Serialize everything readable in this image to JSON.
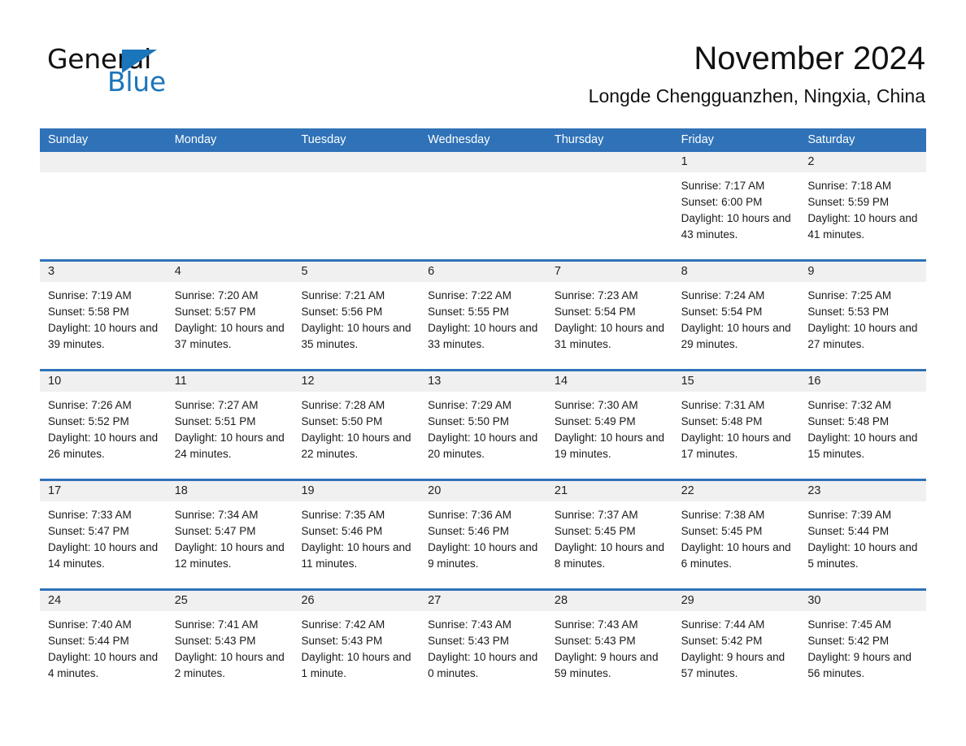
{
  "brand": {
    "name_part1": "General",
    "name_part2": "Blue"
  },
  "header": {
    "title": "November 2024",
    "subtitle": "Longde Chengguanzhen, Ningxia, China"
  },
  "colors": {
    "header_blue": "#2f72b8",
    "brand_blue": "#1b75bb",
    "day_band": "#f0f0f0",
    "text": "#1a1a1a"
  },
  "weekdays": [
    "Sunday",
    "Monday",
    "Tuesday",
    "Wednesday",
    "Thursday",
    "Friday",
    "Saturday"
  ],
  "weeks": [
    [
      {
        "day": "",
        "empty": true
      },
      {
        "day": "",
        "empty": true
      },
      {
        "day": "",
        "empty": true
      },
      {
        "day": "",
        "empty": true
      },
      {
        "day": "",
        "empty": true
      },
      {
        "day": "1",
        "sunrise": "Sunrise: 7:17 AM",
        "sunset": "Sunset: 6:00 PM",
        "daylight": "Daylight: 10 hours and 43 minutes."
      },
      {
        "day": "2",
        "sunrise": "Sunrise: 7:18 AM",
        "sunset": "Sunset: 5:59 PM",
        "daylight": "Daylight: 10 hours and 41 minutes."
      }
    ],
    [
      {
        "day": "3",
        "sunrise": "Sunrise: 7:19 AM",
        "sunset": "Sunset: 5:58 PM",
        "daylight": "Daylight: 10 hours and 39 minutes."
      },
      {
        "day": "4",
        "sunrise": "Sunrise: 7:20 AM",
        "sunset": "Sunset: 5:57 PM",
        "daylight": "Daylight: 10 hours and 37 minutes."
      },
      {
        "day": "5",
        "sunrise": "Sunrise: 7:21 AM",
        "sunset": "Sunset: 5:56 PM",
        "daylight": "Daylight: 10 hours and 35 minutes."
      },
      {
        "day": "6",
        "sunrise": "Sunrise: 7:22 AM",
        "sunset": "Sunset: 5:55 PM",
        "daylight": "Daylight: 10 hours and 33 minutes."
      },
      {
        "day": "7",
        "sunrise": "Sunrise: 7:23 AM",
        "sunset": "Sunset: 5:54 PM",
        "daylight": "Daylight: 10 hours and 31 minutes."
      },
      {
        "day": "8",
        "sunrise": "Sunrise: 7:24 AM",
        "sunset": "Sunset: 5:54 PM",
        "daylight": "Daylight: 10 hours and 29 minutes."
      },
      {
        "day": "9",
        "sunrise": "Sunrise: 7:25 AM",
        "sunset": "Sunset: 5:53 PM",
        "daylight": "Daylight: 10 hours and 27 minutes."
      }
    ],
    [
      {
        "day": "10",
        "sunrise": "Sunrise: 7:26 AM",
        "sunset": "Sunset: 5:52 PM",
        "daylight": "Daylight: 10 hours and 26 minutes."
      },
      {
        "day": "11",
        "sunrise": "Sunrise: 7:27 AM",
        "sunset": "Sunset: 5:51 PM",
        "daylight": "Daylight: 10 hours and 24 minutes."
      },
      {
        "day": "12",
        "sunrise": "Sunrise: 7:28 AM",
        "sunset": "Sunset: 5:50 PM",
        "daylight": "Daylight: 10 hours and 22 minutes."
      },
      {
        "day": "13",
        "sunrise": "Sunrise: 7:29 AM",
        "sunset": "Sunset: 5:50 PM",
        "daylight": "Daylight: 10 hours and 20 minutes."
      },
      {
        "day": "14",
        "sunrise": "Sunrise: 7:30 AM",
        "sunset": "Sunset: 5:49 PM",
        "daylight": "Daylight: 10 hours and 19 minutes."
      },
      {
        "day": "15",
        "sunrise": "Sunrise: 7:31 AM",
        "sunset": "Sunset: 5:48 PM",
        "daylight": "Daylight: 10 hours and 17 minutes."
      },
      {
        "day": "16",
        "sunrise": "Sunrise: 7:32 AM",
        "sunset": "Sunset: 5:48 PM",
        "daylight": "Daylight: 10 hours and 15 minutes."
      }
    ],
    [
      {
        "day": "17",
        "sunrise": "Sunrise: 7:33 AM",
        "sunset": "Sunset: 5:47 PM",
        "daylight": "Daylight: 10 hours and 14 minutes."
      },
      {
        "day": "18",
        "sunrise": "Sunrise: 7:34 AM",
        "sunset": "Sunset: 5:47 PM",
        "daylight": "Daylight: 10 hours and 12 minutes."
      },
      {
        "day": "19",
        "sunrise": "Sunrise: 7:35 AM",
        "sunset": "Sunset: 5:46 PM",
        "daylight": "Daylight: 10 hours and 11 minutes."
      },
      {
        "day": "20",
        "sunrise": "Sunrise: 7:36 AM",
        "sunset": "Sunset: 5:46 PM",
        "daylight": "Daylight: 10 hours and 9 minutes."
      },
      {
        "day": "21",
        "sunrise": "Sunrise: 7:37 AM",
        "sunset": "Sunset: 5:45 PM",
        "daylight": "Daylight: 10 hours and 8 minutes."
      },
      {
        "day": "22",
        "sunrise": "Sunrise: 7:38 AM",
        "sunset": "Sunset: 5:45 PM",
        "daylight": "Daylight: 10 hours and 6 minutes."
      },
      {
        "day": "23",
        "sunrise": "Sunrise: 7:39 AM",
        "sunset": "Sunset: 5:44 PM",
        "daylight": "Daylight: 10 hours and 5 minutes."
      }
    ],
    [
      {
        "day": "24",
        "sunrise": "Sunrise: 7:40 AM",
        "sunset": "Sunset: 5:44 PM",
        "daylight": "Daylight: 10 hours and 4 minutes."
      },
      {
        "day": "25",
        "sunrise": "Sunrise: 7:41 AM",
        "sunset": "Sunset: 5:43 PM",
        "daylight": "Daylight: 10 hours and 2 minutes."
      },
      {
        "day": "26",
        "sunrise": "Sunrise: 7:42 AM",
        "sunset": "Sunset: 5:43 PM",
        "daylight": "Daylight: 10 hours and 1 minute."
      },
      {
        "day": "27",
        "sunrise": "Sunrise: 7:43 AM",
        "sunset": "Sunset: 5:43 PM",
        "daylight": "Daylight: 10 hours and 0 minutes."
      },
      {
        "day": "28",
        "sunrise": "Sunrise: 7:43 AM",
        "sunset": "Sunset: 5:43 PM",
        "daylight": "Daylight: 9 hours and 59 minutes."
      },
      {
        "day": "29",
        "sunrise": "Sunrise: 7:44 AM",
        "sunset": "Sunset: 5:42 PM",
        "daylight": "Daylight: 9 hours and 57 minutes."
      },
      {
        "day": "30",
        "sunrise": "Sunrise: 7:45 AM",
        "sunset": "Sunset: 5:42 PM",
        "daylight": "Daylight: 9 hours and 56 minutes."
      }
    ]
  ]
}
